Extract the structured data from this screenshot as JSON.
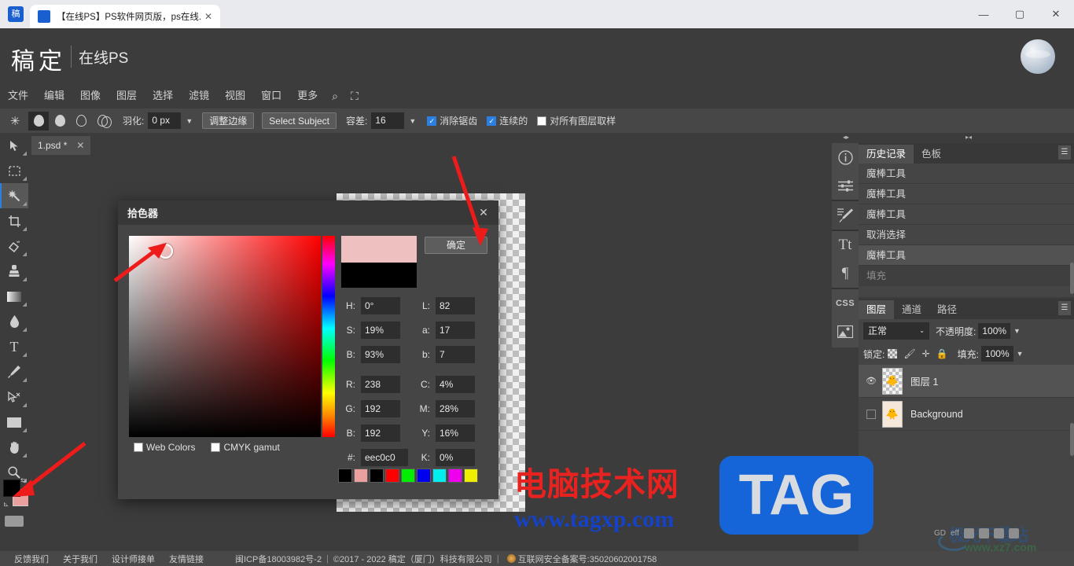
{
  "browser": {
    "tab_title": "【在线PS】PS软件网页版，ps在线...",
    "tab_close": "✕",
    "favicon_text": "稿",
    "minimize": "—",
    "maximize": "▢",
    "close": "✕"
  },
  "header": {
    "logo": "稿定",
    "subtitle": "在线PS"
  },
  "menubar": {
    "items": [
      "文件",
      "编辑",
      "图像",
      "图层",
      "选择",
      "滤镜",
      "视图",
      "窗口",
      "更多"
    ],
    "search_icon": "⌕",
    "fullscreen_icon": "⛶"
  },
  "options_bar": {
    "tool_icon": "✳",
    "selection_modes": [
      "new-selection",
      "add-to-selection",
      "subtract-from-selection",
      "intersect-selection"
    ],
    "feather_label": "羽化:",
    "feather_value": "0 px",
    "feather_caret": "▼",
    "refine_edge_label": "调整边缘",
    "select_subject_label": "Select Subject",
    "tolerance_label": "容差:",
    "tolerance_value": "16",
    "tolerance_caret": "▼",
    "antialias_label": "消除锯齿",
    "antialias_checked": true,
    "contiguous_label": "连续的",
    "contiguous_checked": true,
    "sample_all_layers_label": "对所有图层取样",
    "sample_all_layers_checked": false
  },
  "document_tabs": [
    {
      "name": "1.psd *",
      "close": "✕",
      "active": true
    }
  ],
  "toolbar": {
    "tools": [
      {
        "name": "move-tool",
        "glyph": "➤",
        "active": false
      },
      {
        "name": "marquee-tool",
        "glyph": "▭",
        "active": false
      },
      {
        "name": "magic-wand-tool",
        "glyph": "✳",
        "active": true
      },
      {
        "name": "crop-tool",
        "glyph": "⌗",
        "active": false
      },
      {
        "name": "eraser-tool",
        "glyph": "◇",
        "active": false
      },
      {
        "name": "stamp-tool",
        "glyph": "♟",
        "active": false
      },
      {
        "name": "gradient-tool",
        "glyph": "▬",
        "active": false
      },
      {
        "name": "blur-tool",
        "glyph": "💧",
        "active": false
      },
      {
        "name": "text-tool",
        "glyph": "T",
        "active": false
      },
      {
        "name": "pen-tool",
        "glyph": "✒",
        "active": false
      },
      {
        "name": "path-select-tool",
        "glyph": "↖",
        "active": false
      },
      {
        "name": "shape-tool",
        "glyph": "▬",
        "active": false
      },
      {
        "name": "hand-tool",
        "glyph": "✋",
        "active": false
      },
      {
        "name": "zoom-tool",
        "glyph": "⌕",
        "active": false
      }
    ],
    "foreground_color": "#000000",
    "background_color": "#eba0a0",
    "swap_icon": "⇆",
    "reset_icon": "⊾",
    "keyboard_icon": "keyboard-icon"
  },
  "dialog": {
    "title": "拾色器",
    "close": "✕",
    "ok_label": "确定",
    "new_color": "#eec0c0",
    "current_color": "#000000",
    "fields": [
      {
        "left_label": "H:",
        "left_value": "0°",
        "right_label": "L:",
        "right_value": "82"
      },
      {
        "left_label": "S:",
        "left_value": "19%",
        "right_label": "a:",
        "right_value": "17"
      },
      {
        "left_label": "B:",
        "left_value": "93%",
        "right_label": "b:",
        "right_value": "7"
      },
      {
        "left_label": "R:",
        "left_value": "238",
        "right_label": "C:",
        "right_value": "4%"
      },
      {
        "left_label": "G:",
        "left_value": "192",
        "right_label": "M:",
        "right_value": "28%"
      },
      {
        "left_label": "B:",
        "left_value": "192",
        "right_label": "Y:",
        "right_value": "16%"
      },
      {
        "left_label": "#:",
        "left_value": "eec0c0",
        "right_label": "K:",
        "right_value": "0%"
      }
    ],
    "web_colors_label": "Web Colors",
    "web_colors_checked": false,
    "cmyk_gamut_label": "CMYK gamut",
    "cmyk_gamut_checked": false,
    "swatches": [
      "#000000",
      "#eba0a0",
      "#000000",
      "#ff0000",
      "#00ee00",
      "#0000ee",
      "#00eeee",
      "#ee00ee",
      "#eeee00"
    ]
  },
  "right_panel": {
    "icon_strip": [
      {
        "name": "info-icon",
        "glyph": "ⓘ"
      },
      {
        "name": "adjustments-icon",
        "glyph": "≔"
      },
      {
        "name": "brush-icon",
        "glyph": "🖌"
      },
      {
        "name": "character-icon",
        "glyph": "Tt"
      },
      {
        "name": "paragraph-icon",
        "glyph": "¶"
      },
      {
        "name": "css-icon",
        "glyph": "CSS"
      },
      {
        "name": "image-icon",
        "glyph": "🖼"
      }
    ],
    "history_panel": {
      "tabs": [
        {
          "label": "历史记录",
          "active": true
        },
        {
          "label": "色板",
          "active": false
        }
      ],
      "menu_icon": "☰",
      "items": [
        {
          "label": "魔棒工具",
          "state": "normal"
        },
        {
          "label": "魔棒工具",
          "state": "normal"
        },
        {
          "label": "魔棒工具",
          "state": "normal"
        },
        {
          "label": "取消选择",
          "state": "normal"
        },
        {
          "label": "魔棒工具",
          "state": "selected"
        },
        {
          "label": "填充",
          "state": "dim"
        }
      ]
    },
    "layers_panel": {
      "tabs": [
        {
          "label": "图层",
          "active": true
        },
        {
          "label": "通道",
          "active": false
        },
        {
          "label": "路径",
          "active": false
        }
      ],
      "menu_icon": "☰",
      "blend_mode": "正常",
      "blend_caret": "⌄",
      "opacity_label": "不透明度:",
      "opacity_value": "100%",
      "opacity_caret": "▼",
      "lock_label": "锁定:",
      "lock_icons": [
        "transparency-lock-icon",
        "paint-lock-icon",
        "move-lock-icon",
        "all-lock-icon"
      ],
      "fill_label": "填充:",
      "fill_value": "100%",
      "fill_caret": "▼",
      "layers": [
        {
          "name": "图层 1",
          "visible": true,
          "selected": true,
          "thumb": "transparent"
        },
        {
          "name": "Background",
          "visible": false,
          "selected": false,
          "thumb": "solid"
        }
      ]
    }
  },
  "footer": {
    "links": [
      "反馈我们",
      "关于我们",
      "设计师接单",
      "友情链接"
    ],
    "icp": "闽ICP备18003982号-2",
    "copyright": "©2017 - 2022 稿定（厦门）科技有限公司",
    "security": "互联网安全备案号:35020602001758",
    "separator": "|"
  },
  "watermarks": {
    "center_red": "电脑技术网",
    "center_blue": "www.tagxp.com",
    "center_badge": "TAG",
    "corner_text": "极光下载站",
    "corner_url": "www.xz7.com",
    "status_icons": [
      "GD",
      "eff"
    ]
  }
}
